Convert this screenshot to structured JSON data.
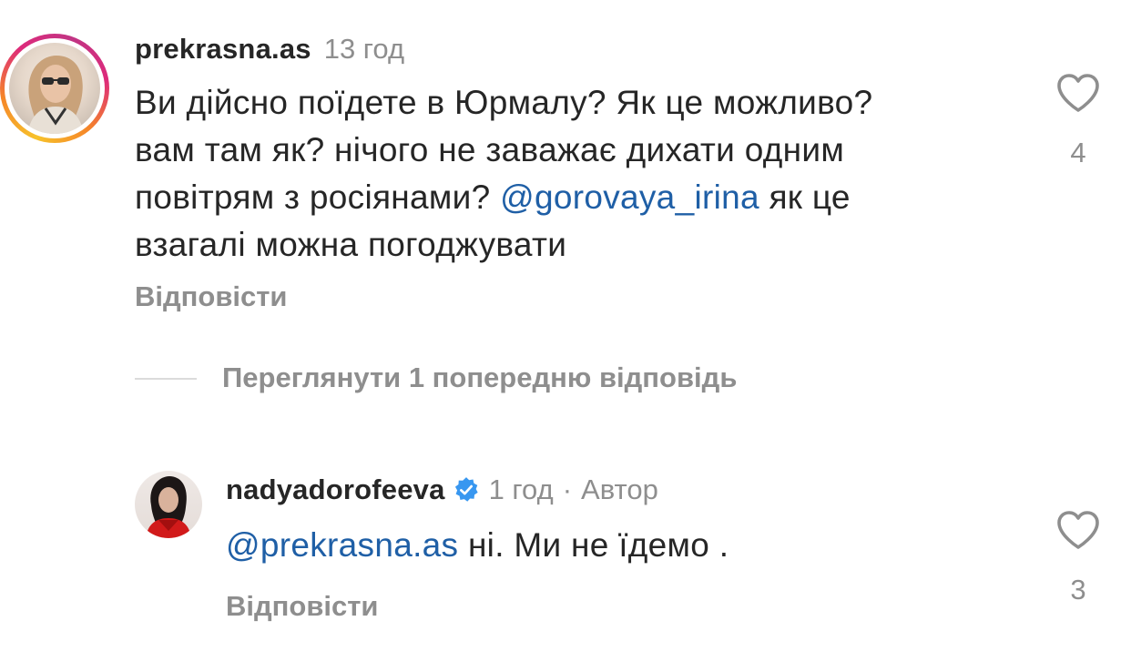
{
  "comments": [
    {
      "username": "prekrasna.as",
      "time": "13 год",
      "text_part1": "Ви дійсно поїдете в Юрмалу? Як це можливо?",
      "text_part2": "вам там як? нічого не заважає дихати одним",
      "text_part3_before": "повітрям з росіянами? ",
      "mention": "@gorovaya_irina",
      "text_part3_after": " як це",
      "text_part4": "взагалі можна погоджувати",
      "reply_label": "Відповісти",
      "likes": "4"
    },
    {
      "username": "nadyadorofeeva",
      "time": "1 год",
      "dot": "·",
      "author_label": "Автор",
      "mention": "@prekrasna.as",
      "text": " ні. Ми не їдемо .",
      "reply_label": "Відповісти",
      "likes": "3"
    }
  ],
  "view_replies_label": "Переглянути 1 попередню відповідь",
  "colors": {
    "text": "#262626",
    "secondary": "#8e8e8e",
    "mention": "#1f5fa6",
    "verified": "#3897f0"
  },
  "icons": {
    "like": "heart-outline-icon",
    "verified": "verified-badge-icon"
  }
}
